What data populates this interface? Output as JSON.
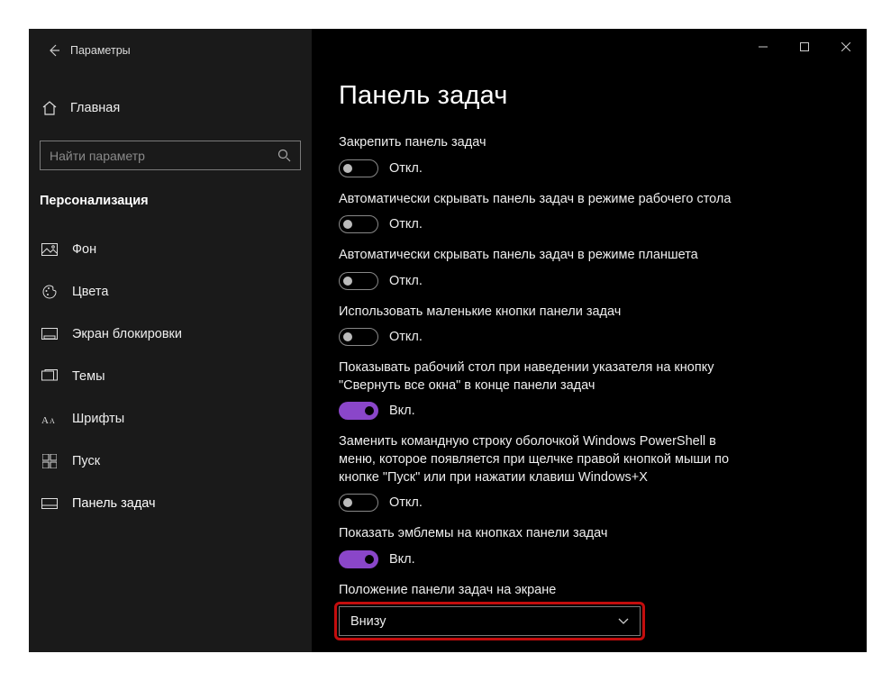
{
  "window": {
    "app_title": "Параметры"
  },
  "sidebar": {
    "home_label": "Главная",
    "search_placeholder": "Найти параметр",
    "section_label": "Персонализация",
    "items": [
      {
        "label": "Фон"
      },
      {
        "label": "Цвета"
      },
      {
        "label": "Экран блокировки"
      },
      {
        "label": "Темы"
      },
      {
        "label": "Шрифты"
      },
      {
        "label": "Пуск"
      },
      {
        "label": "Панель задач"
      }
    ]
  },
  "content": {
    "title": "Панель задач",
    "settings": [
      {
        "label": "Закрепить панель задач",
        "on": false,
        "state": "Откл."
      },
      {
        "label": "Автоматически скрывать панель задач в режиме рабочего стола",
        "on": false,
        "state": "Откл."
      },
      {
        "label": "Автоматически скрывать панель задач в режиме планшета",
        "on": false,
        "state": "Откл."
      },
      {
        "label": "Использовать маленькие кнопки панели задач",
        "on": false,
        "state": "Откл."
      },
      {
        "label": "Показывать рабочий стол при наведении указателя на кнопку \"Свернуть все окна\" в конце панели задач",
        "on": true,
        "state": "Вкл."
      },
      {
        "label": "Заменить командную строку оболочкой Windows PowerShell в меню, которое появляется при щелчке правой кнопкой мыши по кнопке \"Пуск\" или при нажатии клавиш Windows+X",
        "on": false,
        "state": "Откл."
      },
      {
        "label": "Показать эмблемы на кнопках панели задач",
        "on": true,
        "state": "Вкл."
      }
    ],
    "position": {
      "label": "Положение панели задач на экране",
      "value": "Внизу"
    }
  },
  "colors": {
    "accent": "#8a46c9",
    "highlight": "#c30d0d"
  }
}
